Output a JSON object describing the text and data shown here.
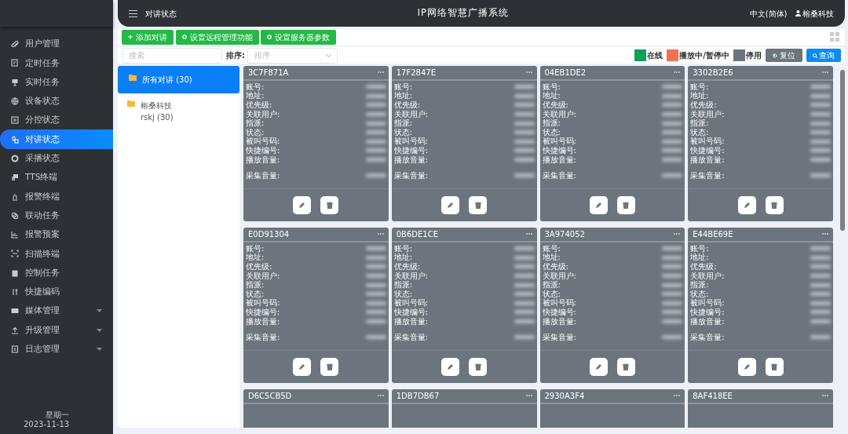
{
  "header": {
    "page_title": "对讲状态",
    "system_title": "IP网络智慧广播系统",
    "language": "中文(简体)",
    "user": "榕桑科技"
  },
  "sidebar": {
    "items": [
      {
        "label": "用户管理",
        "selected": false,
        "submenu": false
      },
      {
        "label": "定时任务",
        "selected": false,
        "submenu": false
      },
      {
        "label": "实时任务",
        "selected": false,
        "submenu": false
      },
      {
        "label": "设备状态",
        "selected": false,
        "submenu": false
      },
      {
        "label": "分控状态",
        "selected": false,
        "submenu": false
      },
      {
        "label": "对讲状态",
        "selected": true,
        "submenu": false
      },
      {
        "label": "采播状态",
        "selected": false,
        "submenu": false
      },
      {
        "label": "TTS终端",
        "selected": false,
        "submenu": false
      },
      {
        "label": "报警终端",
        "selected": false,
        "submenu": false
      },
      {
        "label": "联动任务",
        "selected": false,
        "submenu": false
      },
      {
        "label": "报警预案",
        "selected": false,
        "submenu": false
      },
      {
        "label": "扫描终端",
        "selected": false,
        "submenu": false
      },
      {
        "label": "控制任务",
        "selected": false,
        "submenu": false
      },
      {
        "label": "快捷编码",
        "selected": false,
        "submenu": false
      },
      {
        "label": "媒体管理",
        "selected": false,
        "submenu": true
      },
      {
        "label": "升级管理",
        "selected": false,
        "submenu": true
      },
      {
        "label": "日志管理",
        "selected": false,
        "submenu": true
      }
    ],
    "footer": [
      "星期一",
      "2023-11-13"
    ]
  },
  "toolbar": {
    "buttons": [
      {
        "label": "添加对讲",
        "kind": "add"
      },
      {
        "label": "设置远程管理功能",
        "kind": "settings"
      },
      {
        "label": "设置服务器参数",
        "kind": "settings"
      }
    ]
  },
  "filters": {
    "search_placeholder": "搜索",
    "sort_label": "排序:",
    "sort_placeholder": "排序",
    "legend": [
      {
        "label": "在线",
        "color": "#0e9f5a"
      },
      {
        "label": "播放中/暂停中",
        "color": "#f4704f"
      },
      {
        "label": "停用",
        "color": "#6c757d"
      }
    ],
    "reset_button": "复位",
    "query_button": "查询"
  },
  "tree": [
    {
      "label": "所有对讲 (30)",
      "selected": true
    },
    {
      "label": "榕桑科技",
      "sublabel": "rskj (30)",
      "selected": false
    }
  ],
  "cards": [
    {
      "id": "3C7F871A",
      "fields": [
        "账号:",
        "地址:",
        "优先级:",
        "关联用户:",
        "指派:",
        "状态:",
        "被叫号码:",
        "快捷编号:",
        "播放音量:",
        "采集音量:"
      ]
    },
    {
      "id": "17F2847E",
      "fields": [
        "账号:",
        "地址:",
        "优先级:",
        "关联用户:",
        "指派:",
        "状态:",
        "被叫号码:",
        "快捷编号:",
        "播放音量:",
        "采集音量:"
      ]
    },
    {
      "id": "04EB1DE2",
      "fields": [
        "账号:",
        "地址:",
        "优先级:",
        "关联用户:",
        "指派:",
        "状态:",
        "被叫号码:",
        "快捷编号:",
        "播放音量:",
        "采集音量:"
      ]
    },
    {
      "id": "3302B2E6",
      "fields": [
        "账号:",
        "地址:",
        "优先级:",
        "关联用户:",
        "指派:",
        "状态:",
        "被叫号码:",
        "快捷编号:",
        "播放音量:",
        "采集音量:"
      ]
    },
    {
      "id": "E0D91304",
      "fields": [
        "账号:",
        "地址:",
        "优先级:",
        "关联用户:",
        "指派:",
        "状态:",
        "被叫号码:",
        "快捷编号:",
        "播放音量:",
        "采集音量:"
      ]
    },
    {
      "id": "0B6DE1CE",
      "fields": [
        "账号:",
        "地址:",
        "优先级:",
        "关联用户:",
        "指派:",
        "状态:",
        "被叫号码:",
        "快捷编号:",
        "播放音量:",
        "采集音量:"
      ]
    },
    {
      "id": "3A974052",
      "fields": [
        "账号:",
        "地址:",
        "优先级:",
        "关联用户:",
        "指派:",
        "状态:",
        "被叫号码:",
        "快捷编号:",
        "播放音量:",
        "采集音量:"
      ]
    },
    {
      "id": "E44BE69E",
      "fields": [
        "账号:",
        "地址:",
        "优先级:",
        "关联用户:",
        "指派:",
        "状态:",
        "被叫号码:",
        "快捷编号:",
        "播放音量:",
        "采集音量:"
      ]
    },
    {
      "id": "D6C5CB5D"
    },
    {
      "id": "1DB7DB67"
    },
    {
      "id": "2930A3F4"
    },
    {
      "id": "8AF418EE"
    }
  ]
}
